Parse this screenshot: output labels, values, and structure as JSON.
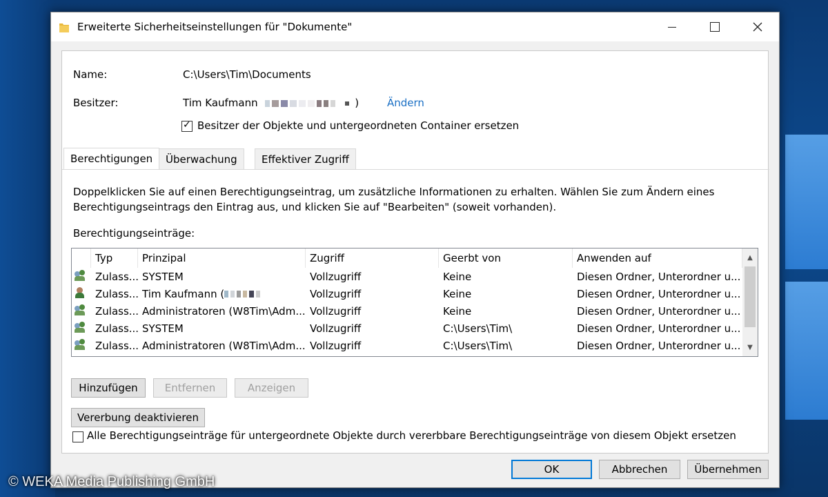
{
  "window": {
    "title": "Erweiterte Sicherheitseinstellungen für \"Dokumente\""
  },
  "info": {
    "name_label": "Name:",
    "name_value": "C:\\Users\\Tim\\Documents",
    "owner_label": "Besitzer:",
    "owner_value": "Tim Kaufmann",
    "owner_close_paren": ")",
    "owner_change_link": "Ändern",
    "replace_owner_label": "Besitzer der Objekte und untergeordneten Container ersetzen",
    "replace_owner_checked": true
  },
  "tabs": [
    {
      "label": "Berechtigungen",
      "active": true
    },
    {
      "label": "Überwachung",
      "active": false
    },
    {
      "label": "Effektiver Zugriff",
      "active": false
    }
  ],
  "permissions": {
    "instructions_line1": "Doppelklicken Sie auf einen Berechtigungseintrag, um zusätzliche Informationen zu erhalten. Wählen Sie zum Ändern eines",
    "instructions_line2": "Berechtigungseintrags den Eintrag aus, und klicken Sie auf \"Bearbeiten\" (soweit vorhanden).",
    "list_label": "Berechtigungseinträge:",
    "columns": [
      "Typ",
      "Prinzipal",
      "Zugriff",
      "Geerbt von",
      "Anwenden auf"
    ],
    "rows": [
      {
        "icon": "group-icon",
        "type": "Zulass...",
        "principal": "SYSTEM",
        "access": "Vollzugriff",
        "inherited": "Keine",
        "applies": "Diesen Ordner, Unterordner u..."
      },
      {
        "icon": "user-icon",
        "type": "Zulass...",
        "principal": "Tim Kaufmann (",
        "access": "Vollzugriff",
        "inherited": "Keine",
        "applies": "Diesen Ordner, Unterordner u..."
      },
      {
        "icon": "group-icon",
        "type": "Zulass...",
        "principal": "Administratoren (W8Tim\\Adm...",
        "access": "Vollzugriff",
        "inherited": "Keine",
        "applies": "Diesen Ordner, Unterordner u..."
      },
      {
        "icon": "group-icon",
        "type": "Zulass...",
        "principal": "SYSTEM",
        "access": "Vollzugriff",
        "inherited": "C:\\Users\\Tim\\",
        "applies": "Diesen Ordner, Unterordner u..."
      },
      {
        "icon": "group-icon",
        "type": "Zulass...",
        "principal": "Administratoren (W8Tim\\Adm...",
        "access": "Vollzugriff",
        "inherited": "C:\\Users\\Tim\\",
        "applies": "Diesen Ordner, Unterordner u..."
      }
    ]
  },
  "actions": {
    "add": "Hinzufügen",
    "remove": "Entfernen",
    "view": "Anzeigen",
    "disable_inheritance": "Vererbung deaktivieren",
    "replace_all_label": "Alle Berechtigungseinträge für untergeordnete Objekte durch vererbbare Berechtigungseinträge von diesem Objekt ersetzen",
    "replace_all_checked": false
  },
  "footer": {
    "ok": "OK",
    "cancel": "Abbrechen",
    "apply": "Übernehmen"
  },
  "watermark": "© WEKA Media Publishing GmbH",
  "colors": {
    "link": "#1a6fc4",
    "default_button_border": "#0078d7"
  }
}
